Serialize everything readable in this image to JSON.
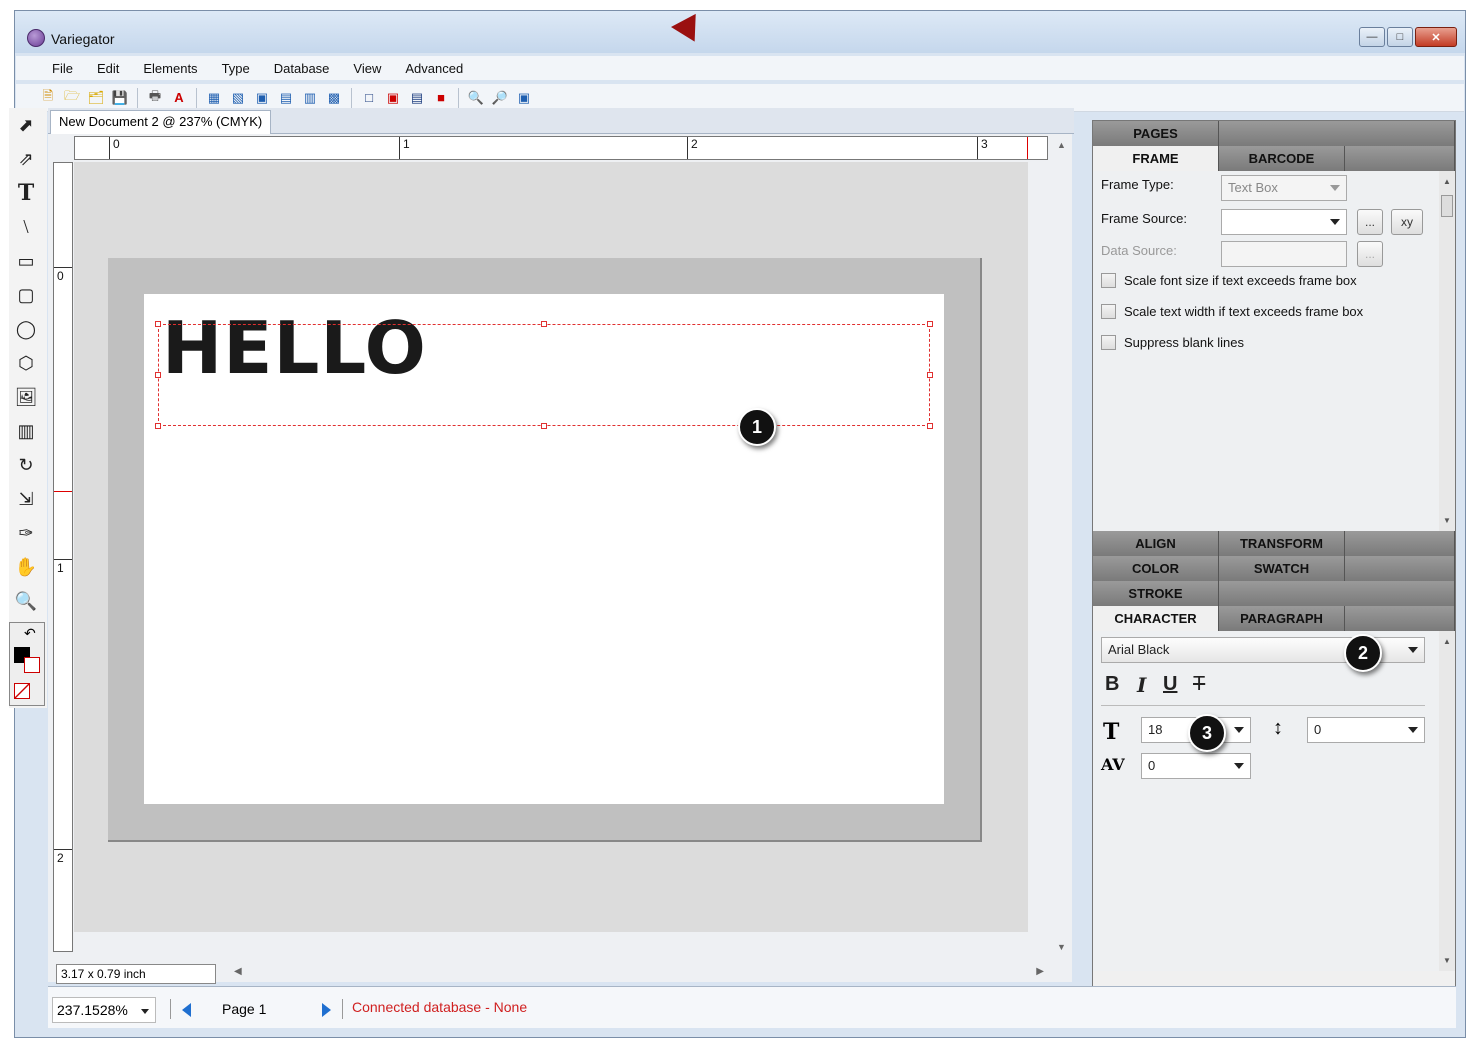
{
  "window": {
    "title": "Variegator"
  },
  "menu": [
    "File",
    "Edit",
    "Elements",
    "Type",
    "Database",
    "View",
    "Advanced"
  ],
  "toolbar_icons": [
    "new-icon",
    "open-icon",
    "open-folder-icon",
    "save-icon",
    "print-icon",
    "pdf-icon",
    "align-icon",
    "distribute-icon",
    "bring-front-icon",
    "send-back-icon",
    "bring-forward-icon",
    "send-backward-icon",
    "frame-icon",
    "frame-red-icon",
    "frame-top-icon",
    "frame-fill-icon",
    "zoom-in-icon",
    "zoom-out-icon",
    "zoom-fit-icon"
  ],
  "tools": [
    "select-arrow-icon",
    "direct-select-icon",
    "text-tool-icon",
    "line-tool-icon",
    "rectangle-tool-icon",
    "rounded-rect-tool-icon",
    "ellipse-tool-icon",
    "polygon-tool-icon",
    "image-tool-icon",
    "barcode-tool-icon",
    "rotate-tool-icon",
    "scale-tool-icon",
    "eyedropper-tool-icon",
    "hand-tool-icon",
    "zoom-tool-icon"
  ],
  "document": {
    "tab_label": "New Document 2 @ 237% (CMYK)",
    "hruler_labels": [
      "0",
      "1",
      "2",
      "3"
    ],
    "vruler_labels": [
      "0",
      "1",
      "2"
    ],
    "text_content": "HELLO",
    "dimensions": "3.17 x 0.79 inch"
  },
  "callouts": [
    "1",
    "2",
    "3"
  ],
  "panel": {
    "tabs_top": [
      "PAGES"
    ],
    "tabs_frame": [
      "FRAME",
      "BARCODE"
    ],
    "frame_type_label": "Frame Type:",
    "frame_type_value": "Text Box",
    "frame_source_label": "Frame Source:",
    "frame_source_value": "",
    "browse_button": "...",
    "xy_button": "xy",
    "data_source_label": "Data Source:",
    "data_source_value": "",
    "options": [
      "Scale font size if text exceeds frame box",
      "Scale text width if text exceeds frame box",
      "Suppress blank lines"
    ],
    "tabs_row1": [
      "ALIGN",
      "TRANSFORM"
    ],
    "tabs_row2": [
      "COLOR",
      "SWATCH"
    ],
    "tabs_row3": [
      "STROKE"
    ],
    "tabs_row4": [
      "CHARACTER",
      "PARAGRAPH"
    ],
    "font": "Arial Black",
    "bold": "B",
    "italic": "I",
    "underline": "U",
    "strike": "T",
    "font_size": "18",
    "leading": "0",
    "tracking": "0"
  },
  "status": {
    "zoom": "237.1528%",
    "page": "Page 1",
    "connection": "Connected database - None"
  },
  "colors": {
    "accent_red": "#d02020",
    "frame_dashed": "#e03030",
    "title_arrow": "#9a1010"
  }
}
